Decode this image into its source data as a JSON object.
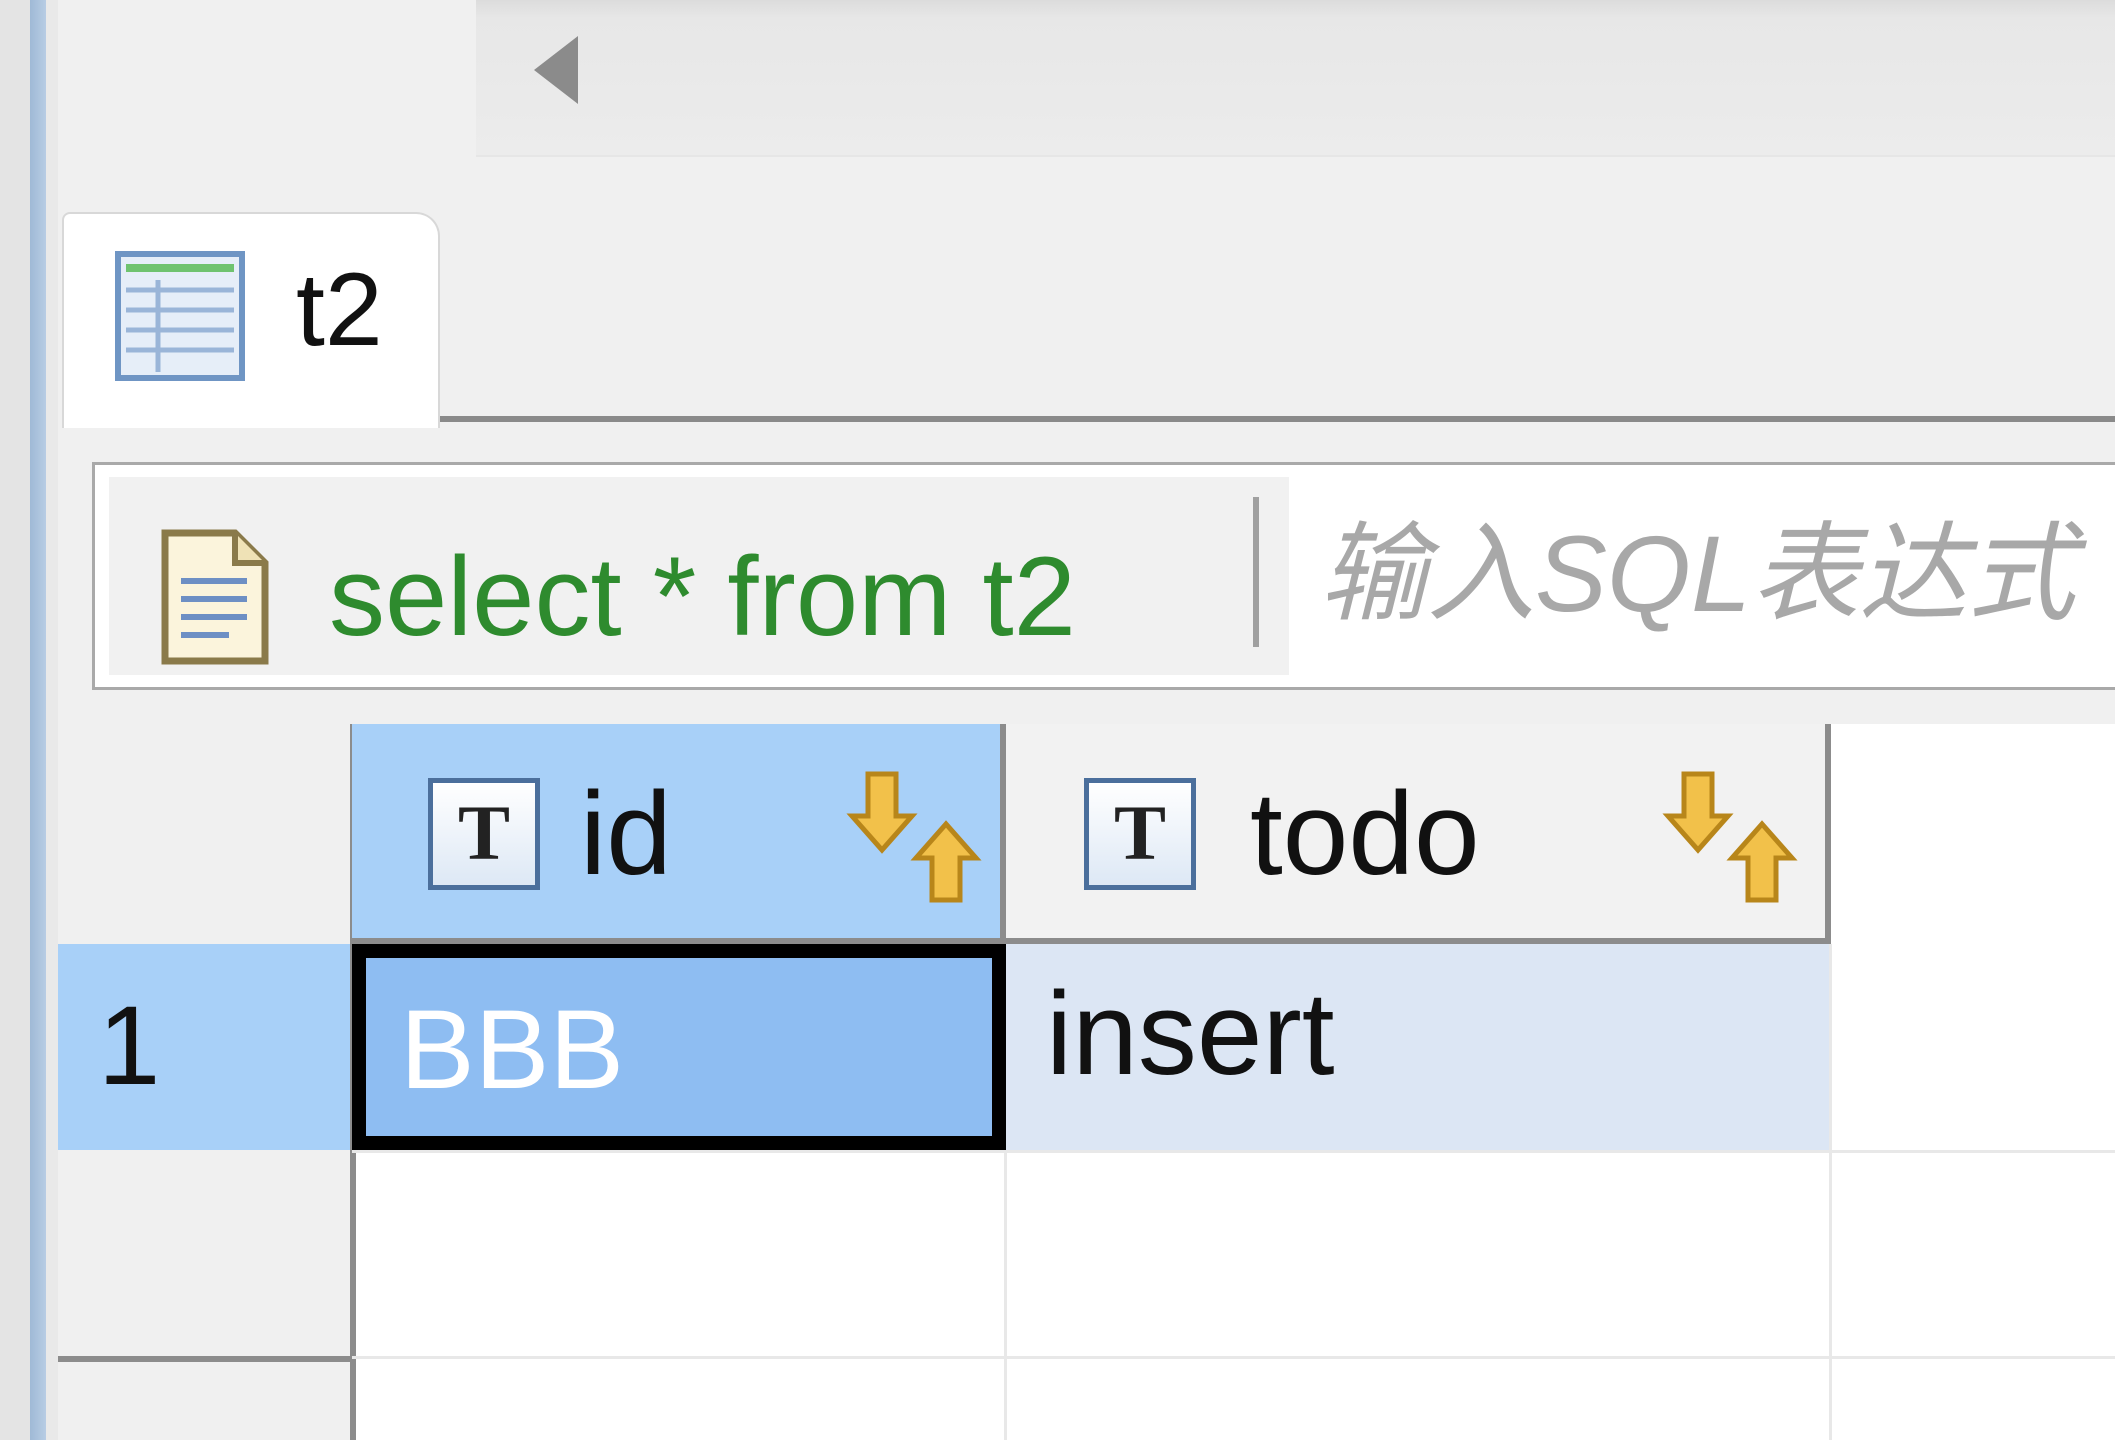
{
  "tab": {
    "label": "t2",
    "icon": "table-icon"
  },
  "filter": {
    "sql": "select * from t2",
    "placeholder": "输入SQL表达式",
    "sql_icon": "document-icon"
  },
  "grid": {
    "columns": [
      {
        "name": "id",
        "type_badge": "T",
        "sort_icon": "sort-arrows-icon"
      },
      {
        "name": "todo",
        "type_badge": "T",
        "sort_icon": "sort-arrows-icon"
      }
    ],
    "rows": [
      {
        "number": "1",
        "id": "BBB",
        "todo": "insert"
      }
    ]
  },
  "colors": {
    "selected_header": "#a8d0f8",
    "selected_cell": "#8ebdf2",
    "row_highlight": "#dce6f4",
    "sql_text": "#2e8b2e"
  }
}
